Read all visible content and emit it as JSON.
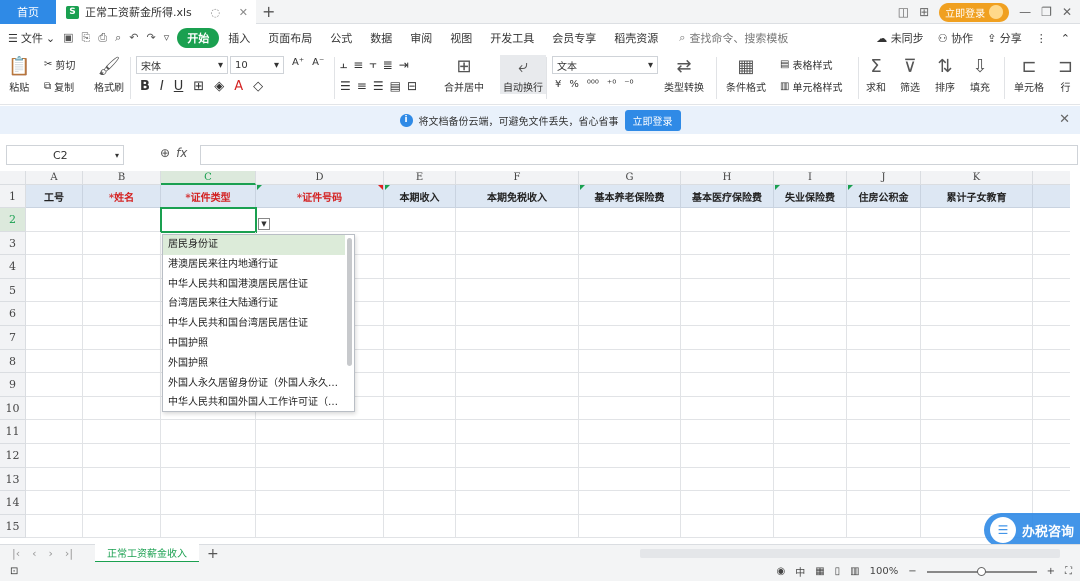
{
  "titlebar": {
    "home_tab": "首页",
    "doc_tab": "正常工资薪金所得.xls",
    "doc_icon": "S",
    "login_button": "立即登录"
  },
  "menubar": {
    "file": "文件",
    "items": [
      "开始",
      "插入",
      "页面布局",
      "公式",
      "数据",
      "审阅",
      "视图",
      "开发工具",
      "会员专享",
      "稻壳资源"
    ],
    "search": "查找命令、搜索模板",
    "unsync": "未同步",
    "collab": "协作",
    "share": "分享"
  },
  "ribbon": {
    "paste": "粘贴",
    "cut": "剪切",
    "copy": "复制",
    "format_painter": "格式刷",
    "font_name": "宋体",
    "font_size": "10",
    "merge_center": "合并居中",
    "wrap": "自动换行",
    "number_format": "文本",
    "type_convert": "类型转换",
    "cond_format": "条件格式",
    "table_style": "表格样式",
    "cell_style": "单元格样式",
    "sum": "求和",
    "filter": "筛选",
    "sort": "排序",
    "fill": "填充",
    "cells": "单元格",
    "row_col": "行"
  },
  "notice": {
    "text": "将文档备份云端，可避免文件丢失，省心省事",
    "button": "立即登录"
  },
  "formula_bar": {
    "name_box": "C2",
    "fx": "fx",
    "value": ""
  },
  "grid": {
    "columns": [
      "A",
      "B",
      "C",
      "D",
      "E",
      "F",
      "G",
      "H",
      "I",
      "J",
      "K"
    ],
    "rows": [
      "1",
      "2",
      "3",
      "4",
      "5",
      "6",
      "7",
      "8",
      "9",
      "10",
      "11",
      "12",
      "13",
      "14",
      "15"
    ],
    "header_row": [
      {
        "text": "工号",
        "required": false
      },
      {
        "text": "*姓名",
        "required": true
      },
      {
        "text": "*证件类型",
        "required": true
      },
      {
        "text": "*证件号码",
        "required": true
      },
      {
        "text": "本期收入",
        "required": false
      },
      {
        "text": "本期免税收入",
        "required": false
      },
      {
        "text": "基本养老保险费",
        "required": false
      },
      {
        "text": "基本医疗保险费",
        "required": false
      },
      {
        "text": "失业保险费",
        "required": false
      },
      {
        "text": "住房公积金",
        "required": false
      },
      {
        "text": "累计子女教育",
        "required": false
      }
    ],
    "selected_cell": "C2"
  },
  "dropdown": {
    "options": [
      "居民身份证",
      "港澳居民来往内地通行证",
      "中华人民共和国港澳居民居住证",
      "台湾居民来往大陆通行证",
      "中华人民共和国台湾居民居住证",
      "中国护照",
      "外国护照",
      "外国人永久居留身份证（外国人永久…",
      "中华人民共和国外国人工作许可证（…"
    ],
    "highlighted_index": 0
  },
  "tax_widget": {
    "label": "办税咨询"
  },
  "sheets": {
    "tabs": [
      "正常工资薪金收入"
    ],
    "active": 0
  },
  "statusbar": {
    "input_mode": "中",
    "zoom": "100%"
  }
}
